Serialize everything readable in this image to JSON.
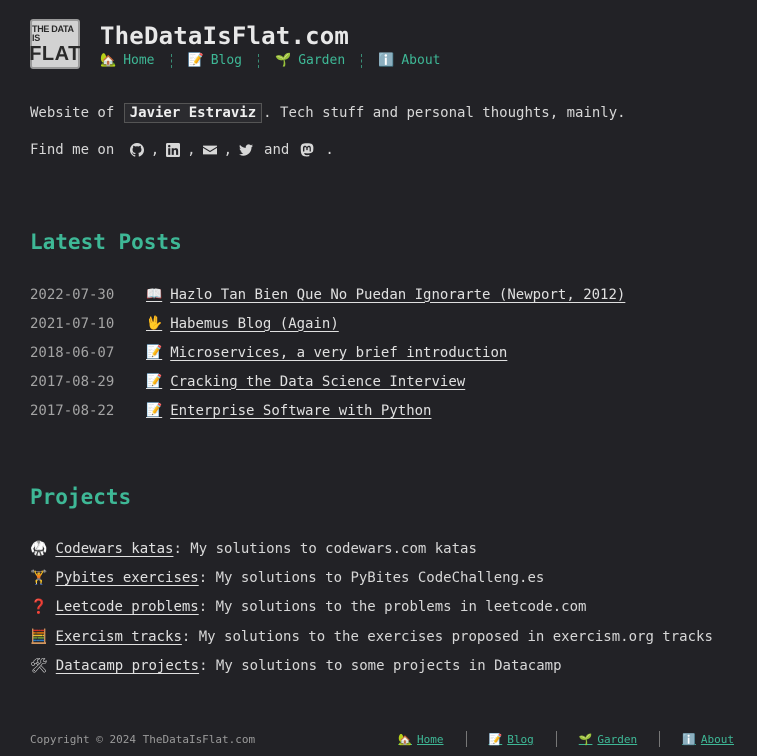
{
  "logo": {
    "line1": "THE DATA IS",
    "line2": "FLAT"
  },
  "site_title": "TheDataIsFlat.com",
  "nav": [
    {
      "icon": "🏡",
      "label": "Home"
    },
    {
      "icon": "📝",
      "label": "Blog"
    },
    {
      "icon": "🌱",
      "label": "Garden"
    },
    {
      "icon": "ℹ️",
      "label": "About"
    }
  ],
  "intro": {
    "before": "Website of ",
    "name": "Javier Estraviz",
    "after": ". Tech stuff and personal thoughts, mainly."
  },
  "find": {
    "prefix": "Find me on ",
    "comma": ",",
    "and": "and",
    "end": ".",
    "icons": [
      "github-icon",
      "linkedin-icon",
      "email-icon",
      "twitter-icon",
      "mastodon-icon"
    ]
  },
  "latest_posts": {
    "heading": "Latest Posts",
    "items": [
      {
        "date": "2022-07-30",
        "icon": "📖",
        "title": "Hazlo Tan Bien Que No Puedan Ignorarte (Newport, 2012)"
      },
      {
        "date": "2021-07-10",
        "icon": "🖖",
        "title": "Habemus Blog (Again)"
      },
      {
        "date": "2018-06-07",
        "icon": "📝",
        "title": "Microservices, a very brief introduction"
      },
      {
        "date": "2017-08-29",
        "icon": "📝",
        "title": "Cracking the Data Science Interview"
      },
      {
        "date": "2017-08-22",
        "icon": "📝",
        "title": "Enterprise Software with Python"
      }
    ]
  },
  "projects": {
    "heading": "Projects",
    "items": [
      {
        "icon": "🥋",
        "title": "Codewars katas",
        "desc": ": My solutions to codewars.com katas"
      },
      {
        "icon": "🏋",
        "title": "Pybites exercises",
        "desc": ": My solutions to PyBites CodeChalleng.es"
      },
      {
        "icon": "❓",
        "title": "Leetcode problems",
        "desc": ": My solutions to the problems in leetcode.com"
      },
      {
        "icon": "🧮",
        "title": "Exercism tracks",
        "desc": ": My solutions to the exercises proposed in exercism.org tracks"
      },
      {
        "icon": "🛠",
        "title": "Datacamp projects",
        "desc": ": My solutions to some projects in Datacamp"
      }
    ]
  },
  "footer": {
    "copyright": "Copyright © 2024 TheDataIsFlat.com",
    "nav": [
      {
        "icon": "🏡",
        "label": "Home"
      },
      {
        "icon": "📝",
        "label": "Blog"
      },
      {
        "icon": "🌱",
        "label": "Garden"
      },
      {
        "icon": "ℹ️",
        "label": "About"
      }
    ]
  },
  "colors": {
    "background": "#222226",
    "accent": "#3eb896",
    "text": "#d7d7d7",
    "muted": "#a4a4a4"
  }
}
